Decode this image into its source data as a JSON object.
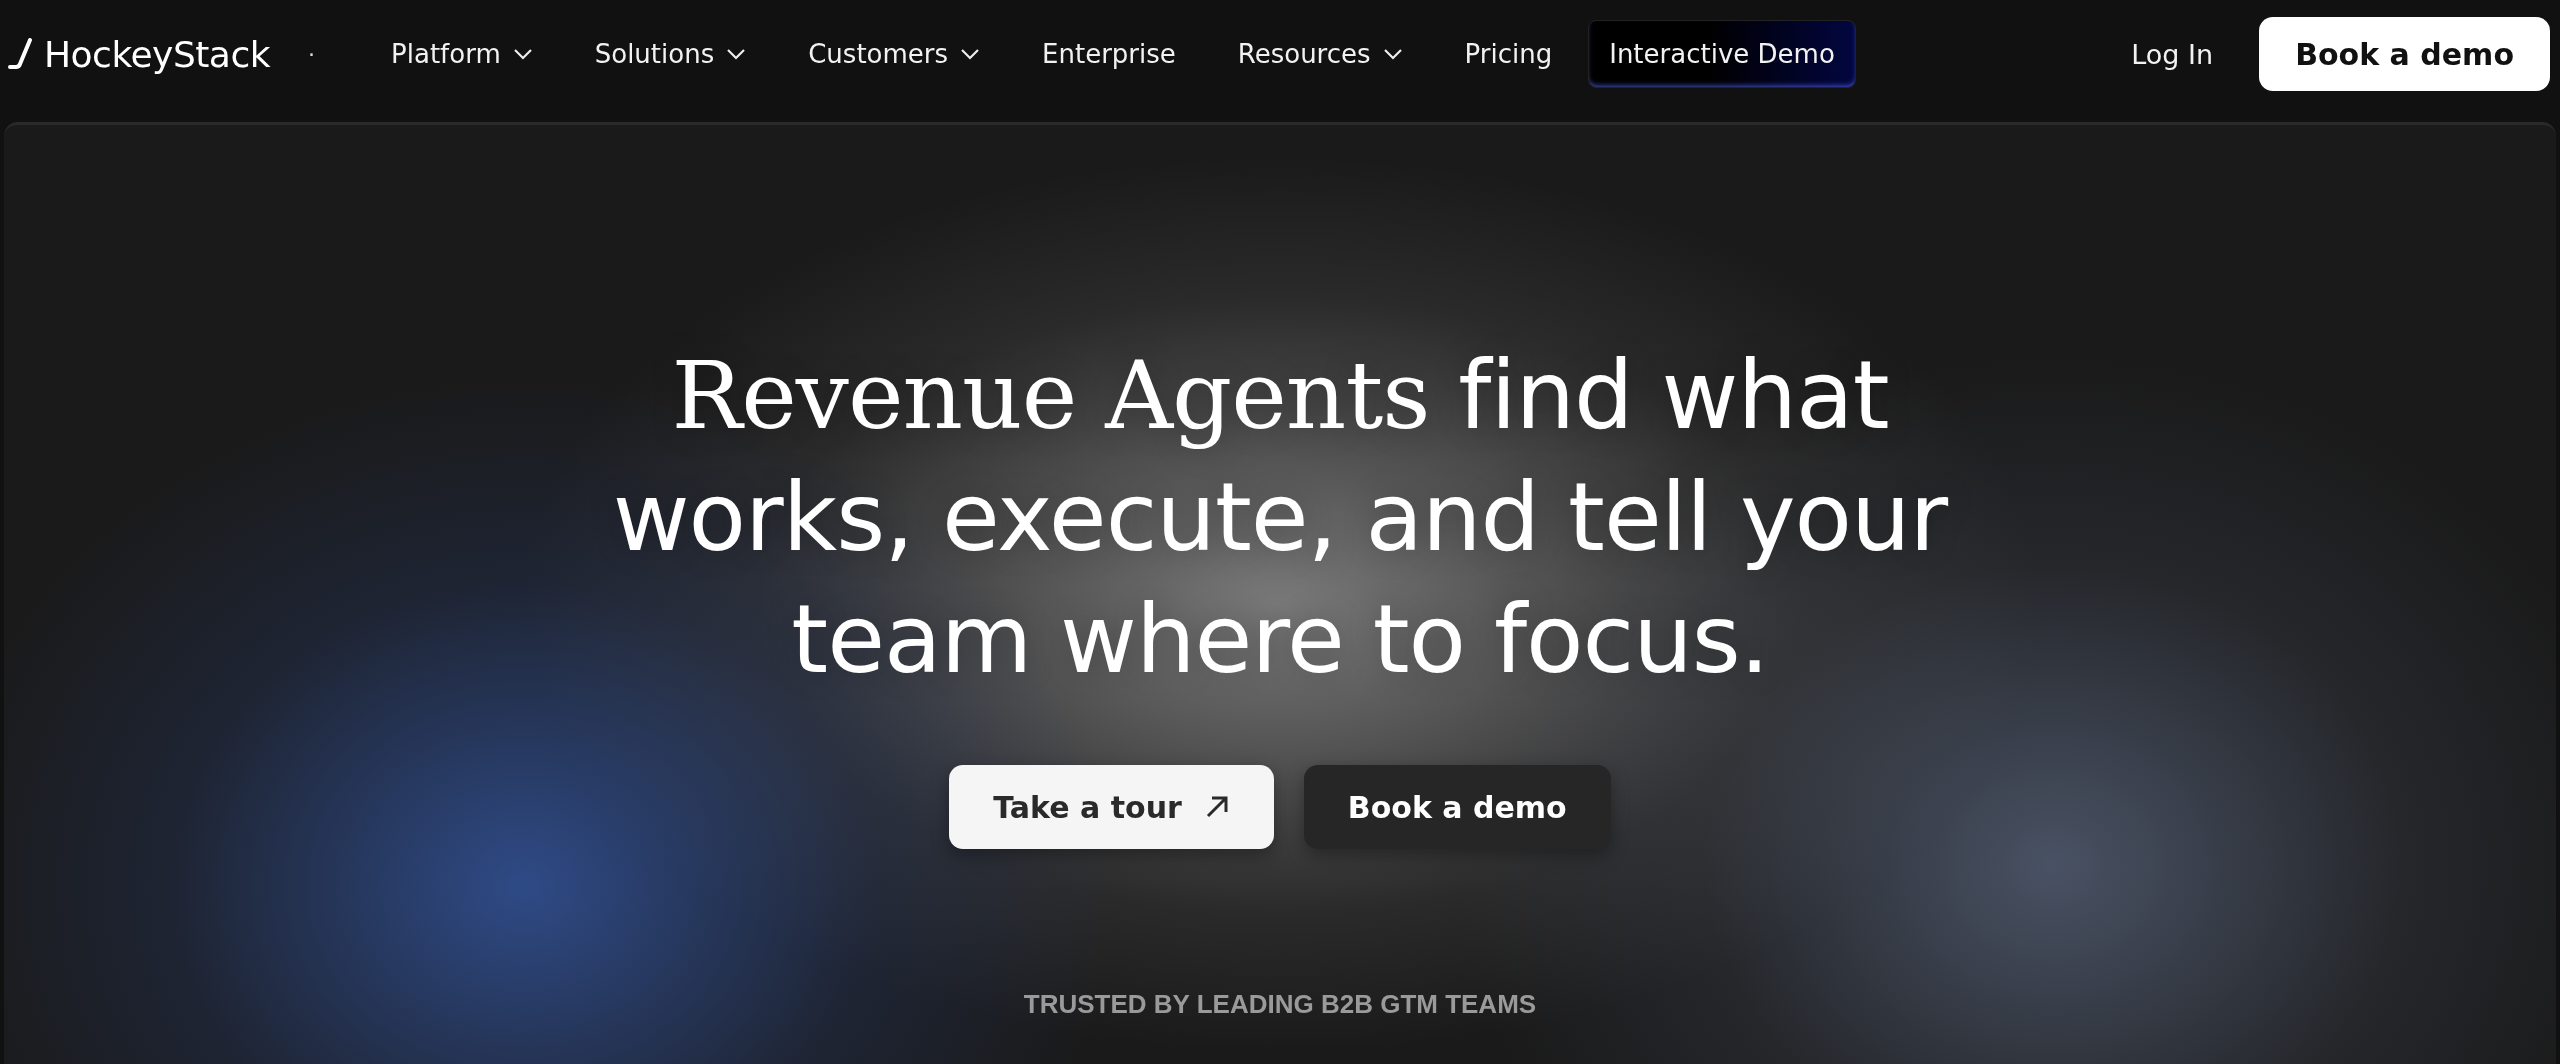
{
  "nav": {
    "logo": "HockeyStack",
    "separator": "·",
    "items": [
      {
        "label": "Platform",
        "kind": "menu"
      },
      {
        "label": "Solutions",
        "kind": "menu"
      },
      {
        "label": "Customers",
        "kind": "menu"
      },
      {
        "label": "Enterprise",
        "kind": "link"
      },
      {
        "label": "Resources",
        "kind": "menu"
      },
      {
        "label": "Pricing",
        "kind": "link"
      },
      {
        "label": "Interactive Demo",
        "kind": "demo"
      }
    ],
    "login": "Log In",
    "cta": "Book a demo"
  },
  "hero": {
    "headline": [
      {
        "text": "Revenue Agents",
        "kind": "serif"
      },
      {
        "text": " find what works, execute, and tell your team where to focus.",
        "kind": "sans"
      }
    ],
    "buttons": [
      {
        "label": "Take a tour",
        "kind": "primary"
      },
      {
        "label": "Book a demo",
        "kind": "secondary"
      }
    ],
    "trusted": "TRUSTED BY LEADING B2B GTM TEAMS"
  }
}
